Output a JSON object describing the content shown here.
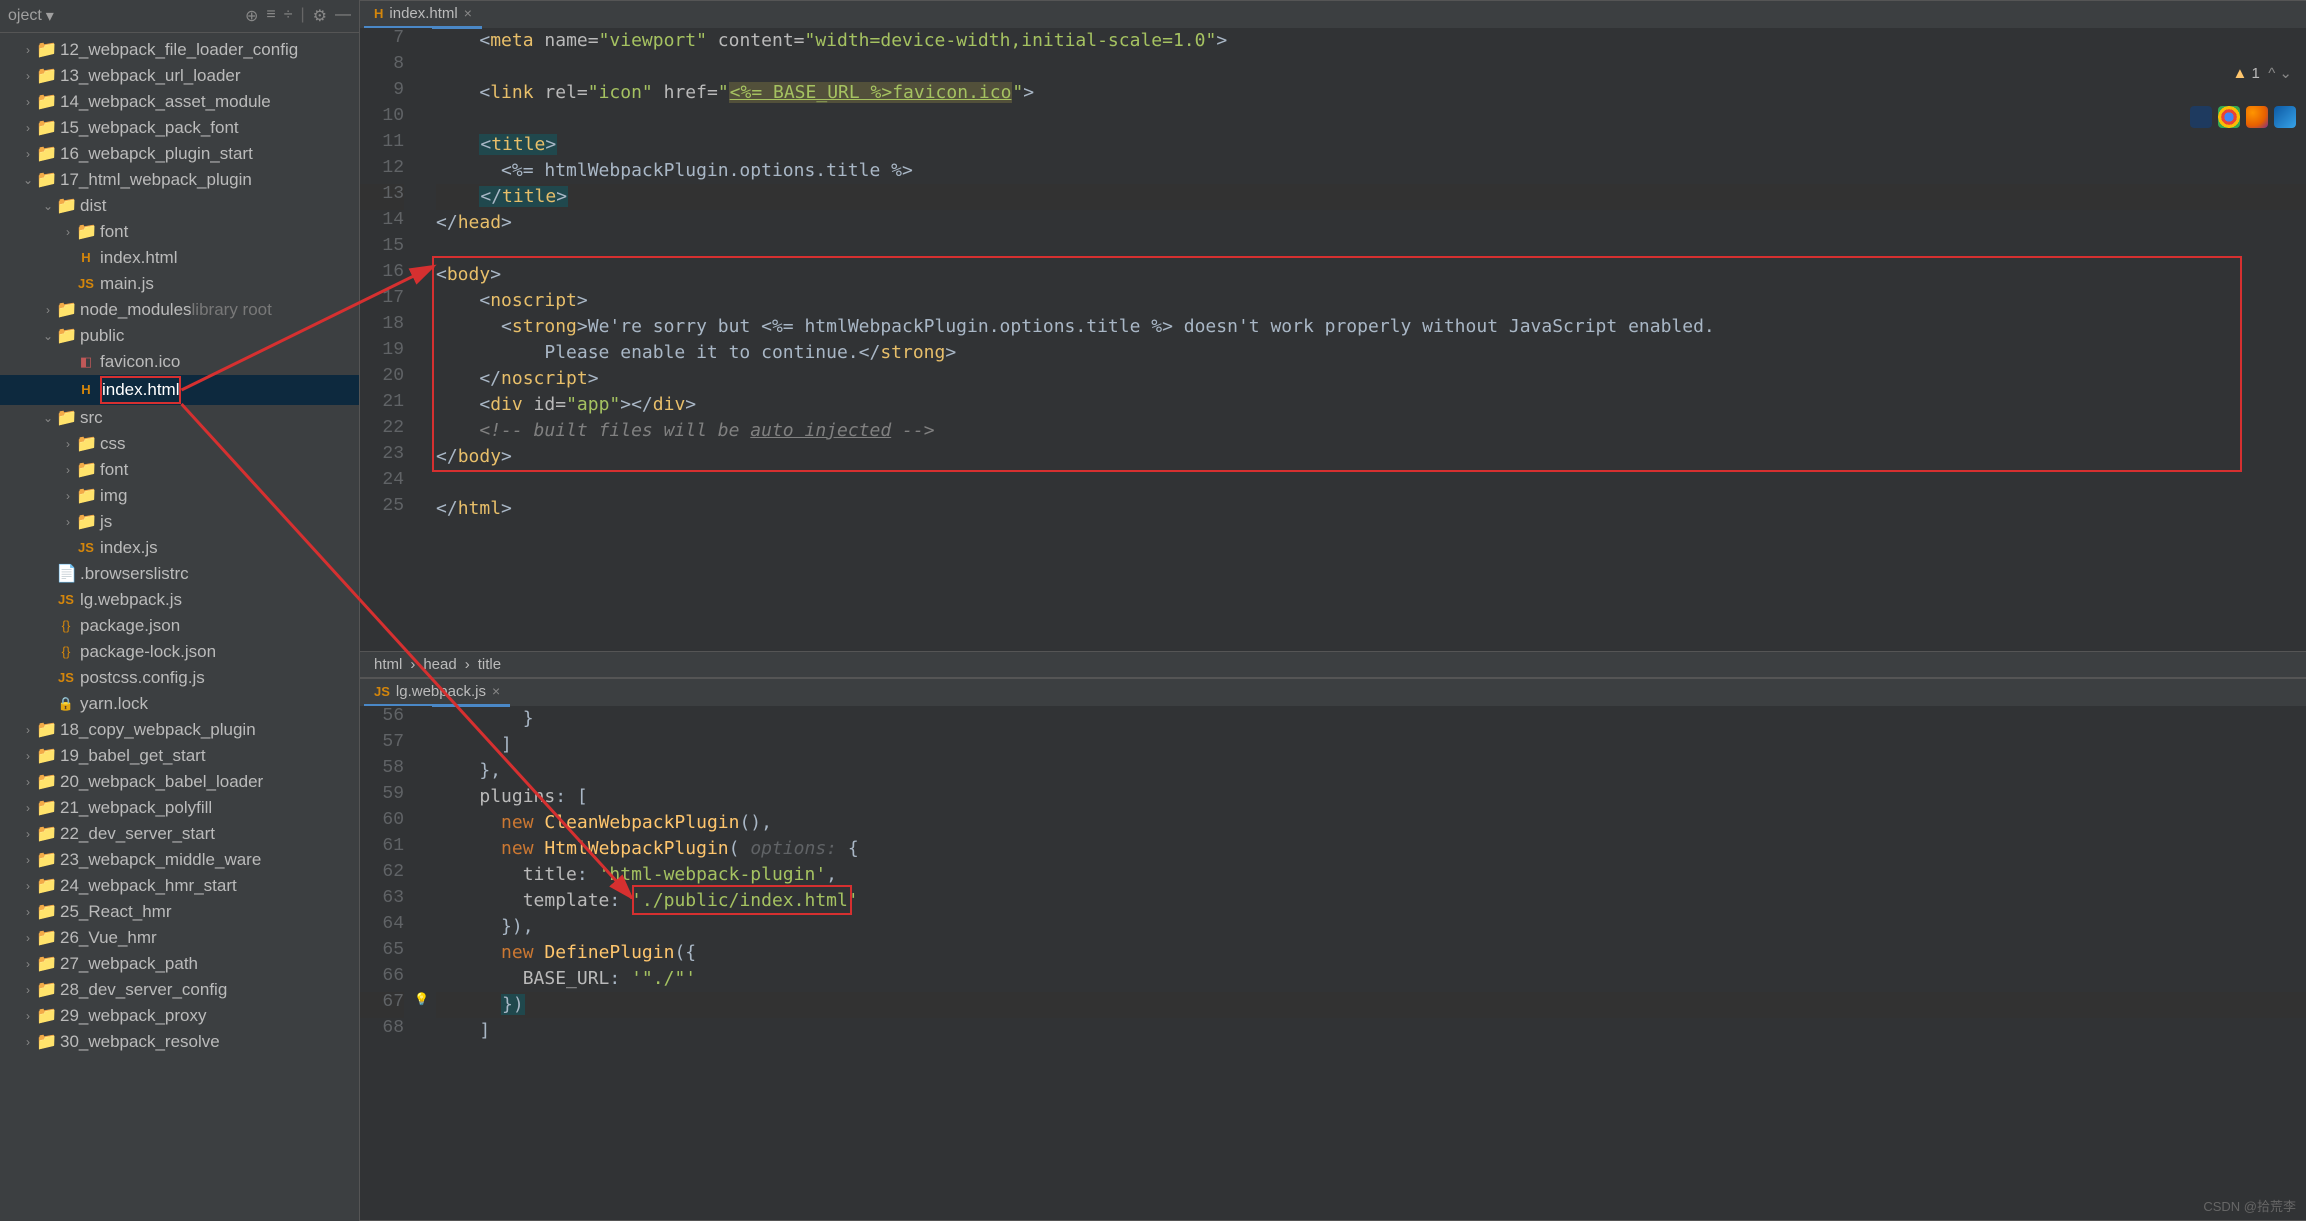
{
  "sidebar": {
    "header_label": "oject",
    "tree": [
      {
        "indent": 0,
        "ch": "›",
        "ic": "folder",
        "label": "12_webpack_file_loader_config"
      },
      {
        "indent": 0,
        "ch": "›",
        "ic": "folder",
        "label": "13_webpack_url_loader"
      },
      {
        "indent": 0,
        "ch": "›",
        "ic": "folder",
        "label": "14_webpack_asset_module"
      },
      {
        "indent": 0,
        "ch": "›",
        "ic": "folder",
        "label": "15_webpack_pack_font"
      },
      {
        "indent": 0,
        "ch": "›",
        "ic": "folder",
        "label": "16_webapck_plugin_start"
      },
      {
        "indent": 0,
        "ch": "⌄",
        "ic": "folder",
        "label": "17_html_webpack_plugin"
      },
      {
        "indent": 1,
        "ch": "⌄",
        "ic": "folder",
        "label": "dist"
      },
      {
        "indent": 2,
        "ch": "›",
        "ic": "folder",
        "label": "font"
      },
      {
        "indent": 2,
        "ch": "",
        "ic": "html",
        "label": "index.html"
      },
      {
        "indent": 2,
        "ch": "",
        "ic": "js",
        "label": "main.js"
      },
      {
        "indent": 1,
        "ch": "›",
        "ic": "folder",
        "label": "node_modules",
        "suffix": "library root"
      },
      {
        "indent": 1,
        "ch": "⌄",
        "ic": "folder",
        "label": "public"
      },
      {
        "indent": 2,
        "ch": "",
        "ic": "ico",
        "label": "favicon.ico"
      },
      {
        "indent": 2,
        "ch": "",
        "ic": "html",
        "label": "index.html",
        "selected": true,
        "boxed": true
      },
      {
        "indent": 1,
        "ch": "⌄",
        "ic": "folder",
        "label": "src"
      },
      {
        "indent": 2,
        "ch": "›",
        "ic": "folder",
        "label": "css"
      },
      {
        "indent": 2,
        "ch": "›",
        "ic": "folder",
        "label": "font"
      },
      {
        "indent": 2,
        "ch": "›",
        "ic": "folder",
        "label": "img"
      },
      {
        "indent": 2,
        "ch": "›",
        "ic": "folder",
        "label": "js"
      },
      {
        "indent": 2,
        "ch": "",
        "ic": "js",
        "label": "index.js"
      },
      {
        "indent": 1,
        "ch": "",
        "ic": "file",
        "label": ".browserslistrc"
      },
      {
        "indent": 1,
        "ch": "",
        "ic": "js",
        "label": "lg.webpack.js"
      },
      {
        "indent": 1,
        "ch": "",
        "ic": "json",
        "label": "package.json"
      },
      {
        "indent": 1,
        "ch": "",
        "ic": "json",
        "label": "package-lock.json"
      },
      {
        "indent": 1,
        "ch": "",
        "ic": "js",
        "label": "postcss.config.js"
      },
      {
        "indent": 1,
        "ch": "",
        "ic": "lock",
        "label": "yarn.lock"
      },
      {
        "indent": 0,
        "ch": "›",
        "ic": "folder",
        "label": "18_copy_webpack_plugin"
      },
      {
        "indent": 0,
        "ch": "›",
        "ic": "folder",
        "label": "19_babel_get_start"
      },
      {
        "indent": 0,
        "ch": "›",
        "ic": "folder",
        "label": "20_webpack_babel_loader"
      },
      {
        "indent": 0,
        "ch": "›",
        "ic": "folder",
        "label": "21_webpack_polyfill"
      },
      {
        "indent": 0,
        "ch": "›",
        "ic": "folder",
        "label": "22_dev_server_start"
      },
      {
        "indent": 0,
        "ch": "›",
        "ic": "folder",
        "label": "23_webapck_middle_ware"
      },
      {
        "indent": 0,
        "ch": "›",
        "ic": "folder",
        "label": "24_webpack_hmr_start"
      },
      {
        "indent": 0,
        "ch": "›",
        "ic": "folder",
        "label": "25_React_hmr"
      },
      {
        "indent": 0,
        "ch": "›",
        "ic": "folder",
        "label": "26_Vue_hmr"
      },
      {
        "indent": 0,
        "ch": "›",
        "ic": "folder",
        "label": "27_webpack_path"
      },
      {
        "indent": 0,
        "ch": "›",
        "ic": "folder",
        "label": "28_dev_server_config"
      },
      {
        "indent": 0,
        "ch": "›",
        "ic": "folder",
        "label": "29_webpack_proxy"
      },
      {
        "indent": 0,
        "ch": "›",
        "ic": "folder",
        "label": "30_webpack_resolve"
      }
    ]
  },
  "top_tab": {
    "file": "index.html"
  },
  "top_lines": [
    {
      "n": 7,
      "html": "    &lt;<span class='tag'>meta</span> <span class='attr'>name=</span><span class='str'>\"viewport\"</span> <span class='attr'>content=</span><span class='str'>\"width=device-width,initial-scale=1.0\"</span>&gt;"
    },
    {
      "n": 8,
      "html": ""
    },
    {
      "n": 9,
      "html": "    &lt;<span class='tag'>link</span> <span class='attr'>rel=</span><span class='str'>\"icon\"</span> <span class='attr'>href=</span><span class='str'>\"<span class='hilight-warn underline'>&lt;%= BASE_URL %&gt;favicon.ico</span>\"</span>&gt;"
    },
    {
      "n": 10,
      "html": ""
    },
    {
      "n": 11,
      "html": "    <span class='hilight-box'>&lt;<span class='tag'>title</span>&gt;</span>"
    },
    {
      "n": 12,
      "html": "      &lt;%= htmlWebpackPlugin.options.title %&gt;"
    },
    {
      "n": 13,
      "html": "    <span class='hilight-box'>&lt;/<span class='tag'>title</span>&gt;</span>",
      "current": true
    },
    {
      "n": 14,
      "html": "&lt;/<span class='tag'>head</span>&gt;"
    },
    {
      "n": 15,
      "html": ""
    },
    {
      "n": 16,
      "html": "&lt;<span class='tag'>body</span>&gt;"
    },
    {
      "n": 17,
      "html": "    &lt;<span class='tag'>noscript</span>&gt;"
    },
    {
      "n": 18,
      "html": "      &lt;<span class='tag'>strong</span>&gt;We're sorry but &lt;%= htmlWebpackPlugin.options.title %&gt; doesn't work properly without JavaScript enabled."
    },
    {
      "n": 19,
      "html": "          Please enable it to continue.&lt;/<span class='tag'>strong</span>&gt;"
    },
    {
      "n": 20,
      "html": "    &lt;/<span class='tag'>noscript</span>&gt;"
    },
    {
      "n": 21,
      "html": "    &lt;<span class='tag'>div</span> <span class='attr'>id=</span><span class='str'>\"app\"</span>&gt;&lt;/<span class='tag'>div</span>&gt;"
    },
    {
      "n": 22,
      "html": "    <span class='comment'>&lt;!-- built files will be <span class='underline'>auto injected</span> --&gt;</span>"
    },
    {
      "n": 23,
      "html": "&lt;/<span class='tag'>body</span>&gt;"
    },
    {
      "n": 24,
      "html": ""
    },
    {
      "n": 25,
      "html": "&lt;/<span class='tag'>html</span>&gt;"
    }
  ],
  "breadcrumb": [
    "html",
    "head",
    "title"
  ],
  "bottom_tab": {
    "file": "lg.webpack.js"
  },
  "bottom_lines": [
    {
      "n": 56,
      "html": "        }"
    },
    {
      "n": 57,
      "html": "      ]"
    },
    {
      "n": 58,
      "html": "    },"
    },
    {
      "n": 59,
      "html": "    <span class='attr'>plugins</span>: ["
    },
    {
      "n": 60,
      "html": "      <span class='kw'>new</span> <span class='fn'>CleanWebpackPlugin</span>(),"
    },
    {
      "n": 61,
      "html": "      <span class='kw'>new</span> <span class='fn'>HtmlWebpackPlugin</span>( <span class='param-hint'>options:</span> {"
    },
    {
      "n": 62,
      "html": "        <span class='attr'>title</span>: <span class='str'>'html-webpack-plugin'</span>,"
    },
    {
      "n": 63,
      "html": "        <span class='attr'>template</span>: <span class='str'>'./public/index.html'</span>"
    },
    {
      "n": 64,
      "html": "      }),"
    },
    {
      "n": 65,
      "html": "      <span class='kw'>new</span> <span class='fn'>DefinePlugin</span>({"
    },
    {
      "n": 66,
      "html": "        <span class='attr'>BASE_URL</span>: <span class='str'>'\"./\"'</span>"
    },
    {
      "n": 67,
      "html": "      <span class='hilight-box'>})</span>",
      "current": true
    },
    {
      "n": 68,
      "html": "    ]"
    }
  ],
  "warning_count": "1",
  "watermark": "CSDN @拾荒李"
}
